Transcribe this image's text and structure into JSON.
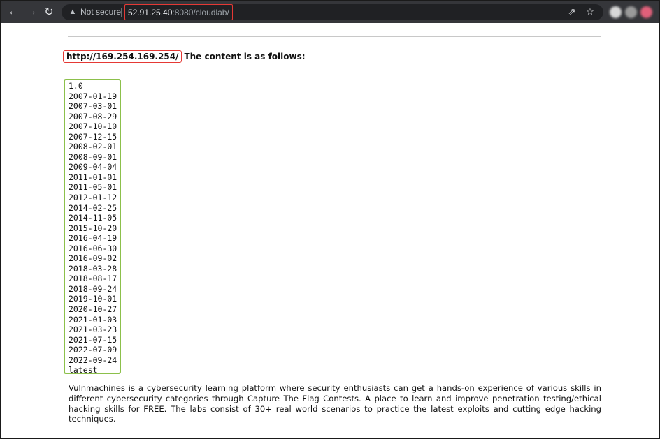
{
  "browser": {
    "security_label": "Not secure",
    "url_host": "52.91.25.40",
    "url_rest": ":8080/cloudlab/",
    "icons": [
      "back-arrow-icon",
      "forward-arrow-icon",
      "reload-icon",
      "warning-icon",
      "share-icon",
      "star-icon"
    ]
  },
  "page": {
    "link_text": "http://169.254.169.254/",
    "heading_text": "The content is as follows:",
    "entries": [
      "1.0",
      "2007-01-19",
      "2007-03-01",
      "2007-08-29",
      "2007-10-10",
      "2007-12-15",
      "2008-02-01",
      "2008-09-01",
      "2009-04-04",
      "2011-01-01",
      "2011-05-01",
      "2012-01-12",
      "2014-02-25",
      "2014-11-05",
      "2015-10-20",
      "2016-04-19",
      "2016-06-30",
      "2016-09-02",
      "2018-03-28",
      "2018-08-17",
      "2018-09-24",
      "2019-10-01",
      "2020-10-27",
      "2021-01-03",
      "2021-03-23",
      "2021-07-15",
      "2022-07-09",
      "2022-09-24",
      "latest"
    ],
    "description": "Vulnmachines is a cybersecurity learning platform where security enthusiasts can get a hands-on experience of various skills in different cybersecurity categories through Capture The Flag Contests. A place to learn and improve penetration testing/ethical hacking skills for FREE. The labs consist of 30+ real world scenarios to practice the latest exploits and cutting edge hacking techniques."
  },
  "colors": {
    "url_highlight": "#e53935",
    "list_highlight": "#8cc04b",
    "toolbar": "#35363a"
  }
}
